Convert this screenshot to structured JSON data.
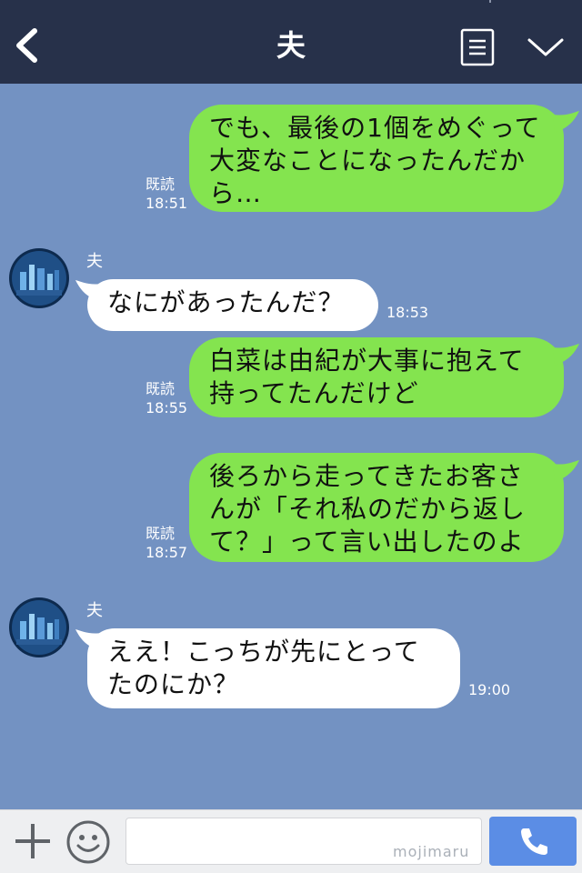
{
  "header": {
    "title": "夫",
    "back_icon": "chevron-left-icon",
    "menu_icon": "note-icon",
    "collapse_icon": "chevron-down-icon"
  },
  "messages": [
    {
      "direction": "outgoing",
      "text": "でも、最後の1個をめぐって大変なことになったんだから…",
      "read": "既読",
      "time": "18:51"
    },
    {
      "direction": "incoming",
      "sender": "夫",
      "text": "なにがあったんだ？",
      "time": "18:53"
    },
    {
      "direction": "outgoing",
      "text": "白菜は由紀が大事に抱えて持ってたんだけど",
      "read": "既読",
      "time": "18:55"
    },
    {
      "direction": "outgoing",
      "text": "後ろから走ってきたお客さんが「それ私のだから返して？」って言い出したのよ",
      "read": "既読",
      "time": "18:57"
    },
    {
      "direction": "incoming",
      "sender": "夫",
      "text": "ええ！こっちが先にとってたのにか？",
      "time": "19:00"
    }
  ],
  "footer": {
    "input_value": "",
    "watermark": "mojimaru",
    "plus_icon": "plus-icon",
    "emoji_icon": "smiley-icon",
    "call_icon": "phone-icon"
  },
  "colors": {
    "header_bg": "#27314a",
    "chat_bg": "#7392c2",
    "outgoing_bubble": "#84e44f",
    "incoming_bubble": "#ffffff",
    "call_button": "#5b8de5"
  }
}
